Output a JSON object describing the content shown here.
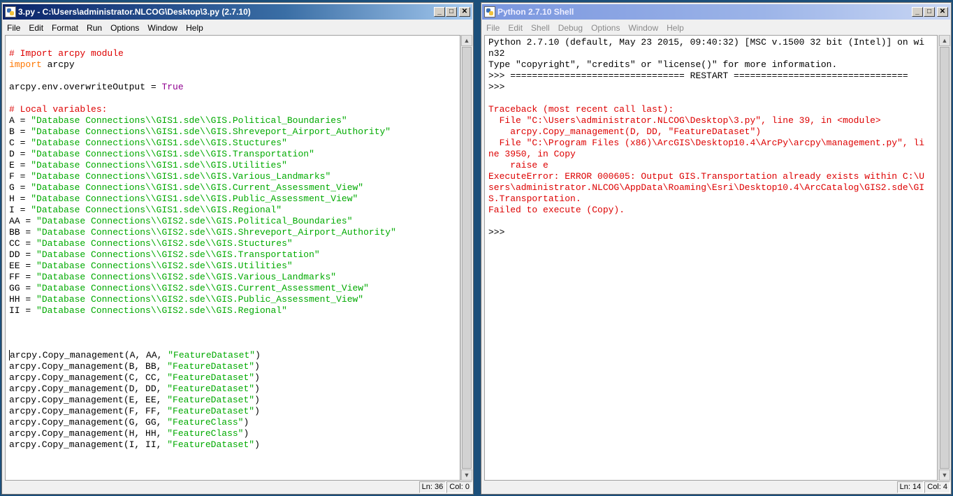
{
  "editor": {
    "title": "3.py - C:\\Users\\administrator.NLCOG\\Desktop\\3.py (2.7.10)",
    "menu": [
      "File",
      "Edit",
      "Format",
      "Run",
      "Options",
      "Window",
      "Help"
    ],
    "status_line": "Ln: 36",
    "status_col": "Col: 0",
    "lines": [
      [],
      [
        {
          "t": "# Import arcpy module",
          "c": "comment"
        }
      ],
      [
        {
          "t": "import",
          "c": "kw"
        },
        {
          "t": " arcpy",
          "c": "plain"
        }
      ],
      [],
      [
        {
          "t": "arcpy.env.overwriteOutput = ",
          "c": "plain"
        },
        {
          "t": "True",
          "c": "builtin"
        }
      ],
      [],
      [
        {
          "t": "# Local variables:",
          "c": "comment"
        }
      ],
      [
        {
          "t": "A = ",
          "c": "plain"
        },
        {
          "t": "\"Database Connections\\\\GIS1.sde\\\\GIS.Political_Boundaries\"",
          "c": "str"
        }
      ],
      [
        {
          "t": "B = ",
          "c": "plain"
        },
        {
          "t": "\"Database Connections\\\\GIS1.sde\\\\GIS.Shreveport_Airport_Authority\"",
          "c": "str"
        }
      ],
      [
        {
          "t": "C = ",
          "c": "plain"
        },
        {
          "t": "\"Database Connections\\\\GIS1.sde\\\\GIS.Stuctures\"",
          "c": "str"
        }
      ],
      [
        {
          "t": "D = ",
          "c": "plain"
        },
        {
          "t": "\"Database Connections\\\\GIS1.sde\\\\GIS.Transportation\"",
          "c": "str"
        }
      ],
      [
        {
          "t": "E = ",
          "c": "plain"
        },
        {
          "t": "\"Database Connections\\\\GIS1.sde\\\\GIS.Utilities\"",
          "c": "str"
        }
      ],
      [
        {
          "t": "F = ",
          "c": "plain"
        },
        {
          "t": "\"Database Connections\\\\GIS1.sde\\\\GIS.Various_Landmarks\"",
          "c": "str"
        }
      ],
      [
        {
          "t": "G = ",
          "c": "plain"
        },
        {
          "t": "\"Database Connections\\\\GIS1.sde\\\\GIS.Current_Assessment_View\"",
          "c": "str"
        }
      ],
      [
        {
          "t": "H = ",
          "c": "plain"
        },
        {
          "t": "\"Database Connections\\\\GIS1.sde\\\\GIS.Public_Assessment_View\"",
          "c": "str"
        }
      ],
      [
        {
          "t": "I = ",
          "c": "plain"
        },
        {
          "t": "\"Database Connections\\\\GIS1.sde\\\\GIS.Regional\"",
          "c": "str"
        }
      ],
      [
        {
          "t": "AA = ",
          "c": "plain"
        },
        {
          "t": "\"Database Connections\\\\GIS2.sde\\\\GIS.Political_Boundaries\"",
          "c": "str"
        }
      ],
      [
        {
          "t": "BB = ",
          "c": "plain"
        },
        {
          "t": "\"Database Connections\\\\GIS2.sde\\\\GIS.Shreveport_Airport_Authority\"",
          "c": "str"
        }
      ],
      [
        {
          "t": "CC = ",
          "c": "plain"
        },
        {
          "t": "\"Database Connections\\\\GIS2.sde\\\\GIS.Stuctures\"",
          "c": "str"
        }
      ],
      [
        {
          "t": "DD = ",
          "c": "plain"
        },
        {
          "t": "\"Database Connections\\\\GIS2.sde\\\\GIS.Transportation\"",
          "c": "str"
        }
      ],
      [
        {
          "t": "EE = ",
          "c": "plain"
        },
        {
          "t": "\"Database Connections\\\\GIS2.sde\\\\GIS.Utilities\"",
          "c": "str"
        }
      ],
      [
        {
          "t": "FF = ",
          "c": "plain"
        },
        {
          "t": "\"Database Connections\\\\GIS2.sde\\\\GIS.Various_Landmarks\"",
          "c": "str"
        }
      ],
      [
        {
          "t": "GG = ",
          "c": "plain"
        },
        {
          "t": "\"Database Connections\\\\GIS2.sde\\\\GIS.Current_Assessment_View\"",
          "c": "str"
        }
      ],
      [
        {
          "t": "HH = ",
          "c": "plain"
        },
        {
          "t": "\"Database Connections\\\\GIS2.sde\\\\GIS.Public_Assessment_View\"",
          "c": "str"
        }
      ],
      [
        {
          "t": "II = ",
          "c": "plain"
        },
        {
          "t": "\"Database Connections\\\\GIS2.sde\\\\GIS.Regional\"",
          "c": "str"
        }
      ],
      [],
      [],
      [],
      [
        {
          "t": "arcpy.Copy_management(A, AA, ",
          "c": "plain",
          "cursor": true
        },
        {
          "t": "\"FeatureDataset\"",
          "c": "str"
        },
        {
          "t": ")",
          "c": "plain"
        }
      ],
      [
        {
          "t": "arcpy.Copy_management(B, BB, ",
          "c": "plain"
        },
        {
          "t": "\"FeatureDataset\"",
          "c": "str"
        },
        {
          "t": ")",
          "c": "plain"
        }
      ],
      [
        {
          "t": "arcpy.Copy_management(C, CC, ",
          "c": "plain"
        },
        {
          "t": "\"FeatureDataset\"",
          "c": "str"
        },
        {
          "t": ")",
          "c": "plain"
        }
      ],
      [
        {
          "t": "arcpy.Copy_management(D, DD, ",
          "c": "plain"
        },
        {
          "t": "\"FeatureDataset\"",
          "c": "str"
        },
        {
          "t": ")",
          "c": "plain"
        }
      ],
      [
        {
          "t": "arcpy.Copy_management(E, EE, ",
          "c": "plain"
        },
        {
          "t": "\"FeatureDataset\"",
          "c": "str"
        },
        {
          "t": ")",
          "c": "plain"
        }
      ],
      [
        {
          "t": "arcpy.Copy_management(F, FF, ",
          "c": "plain"
        },
        {
          "t": "\"FeatureDataset\"",
          "c": "str"
        },
        {
          "t": ")",
          "c": "plain"
        }
      ],
      [
        {
          "t": "arcpy.Copy_management(G, GG, ",
          "c": "plain"
        },
        {
          "t": "\"FeatureClass\"",
          "c": "str"
        },
        {
          "t": ")",
          "c": "plain"
        }
      ],
      [
        {
          "t": "arcpy.Copy_management(H, HH, ",
          "c": "plain"
        },
        {
          "t": "\"FeatureClass\"",
          "c": "str"
        },
        {
          "t": ")",
          "c": "plain"
        }
      ],
      [
        {
          "t": "arcpy.Copy_management(I, II, ",
          "c": "plain"
        },
        {
          "t": "\"FeatureDataset\"",
          "c": "str"
        },
        {
          "t": ")",
          "c": "plain"
        }
      ]
    ]
  },
  "shell": {
    "title": "Python 2.7.10 Shell",
    "menu": [
      "File",
      "Edit",
      "Shell",
      "Debug",
      "Options",
      "Window",
      "Help"
    ],
    "status_line": "Ln: 14",
    "status_col": "Col: 4",
    "lines": [
      [
        {
          "t": "Python 2.7.10 (default, May 23 2015, 09:40:32) [MSC v.1500 32 bit (Intel)] on wi",
          "c": "plain"
        }
      ],
      [
        {
          "t": "n32",
          "c": "plain"
        }
      ],
      [
        {
          "t": "Type \"copyright\", \"credits\" or \"license()\" for more information.",
          "c": "plain"
        }
      ],
      [
        {
          "t": ">>> ================================ RESTART ================================",
          "c": "plain"
        }
      ],
      [
        {
          "t": ">>>",
          "c": "plain"
        }
      ],
      [],
      [
        {
          "t": "Traceback (most recent call last):",
          "c": "err"
        }
      ],
      [
        {
          "t": "  File \"C:\\Users\\administrator.NLCOG\\Desktop\\3.py\", line 39, in <module>",
          "c": "err"
        }
      ],
      [
        {
          "t": "    arcpy.Copy_management(D, DD, \"FeatureDataset\")",
          "c": "err"
        }
      ],
      [
        {
          "t": "  File \"C:\\Program Files (x86)\\ArcGIS\\Desktop10.4\\ArcPy\\arcpy\\management.py\", li",
          "c": "err"
        }
      ],
      [
        {
          "t": "ne 3950, in Copy",
          "c": "err"
        }
      ],
      [
        {
          "t": "    raise e",
          "c": "err"
        }
      ],
      [
        {
          "t": "ExecuteError: ERROR 000605: Output GIS.Transportation already exists within C:\\U",
          "c": "err"
        }
      ],
      [
        {
          "t": "sers\\administrator.NLCOG\\AppData\\Roaming\\Esri\\Desktop10.4\\ArcCatalog\\GIS2.sde\\GI",
          "c": "err"
        }
      ],
      [
        {
          "t": "S.Transportation.",
          "c": "err"
        }
      ],
      [
        {
          "t": "Failed to execute (Copy).",
          "c": "err"
        }
      ],
      [],
      [
        {
          "t": ">>> ",
          "c": "plain"
        }
      ]
    ]
  },
  "colors": {
    "comment": "#dd0000",
    "keyword": "#ff7700",
    "string": "#00aa00",
    "builtin": "#900090",
    "error": "#dd0000",
    "titlebar_active": "#0a246a"
  },
  "icons": {
    "app": "python-idle-icon",
    "minimize": "minimize-icon",
    "maximize": "maximize-icon",
    "close": "close-icon"
  }
}
